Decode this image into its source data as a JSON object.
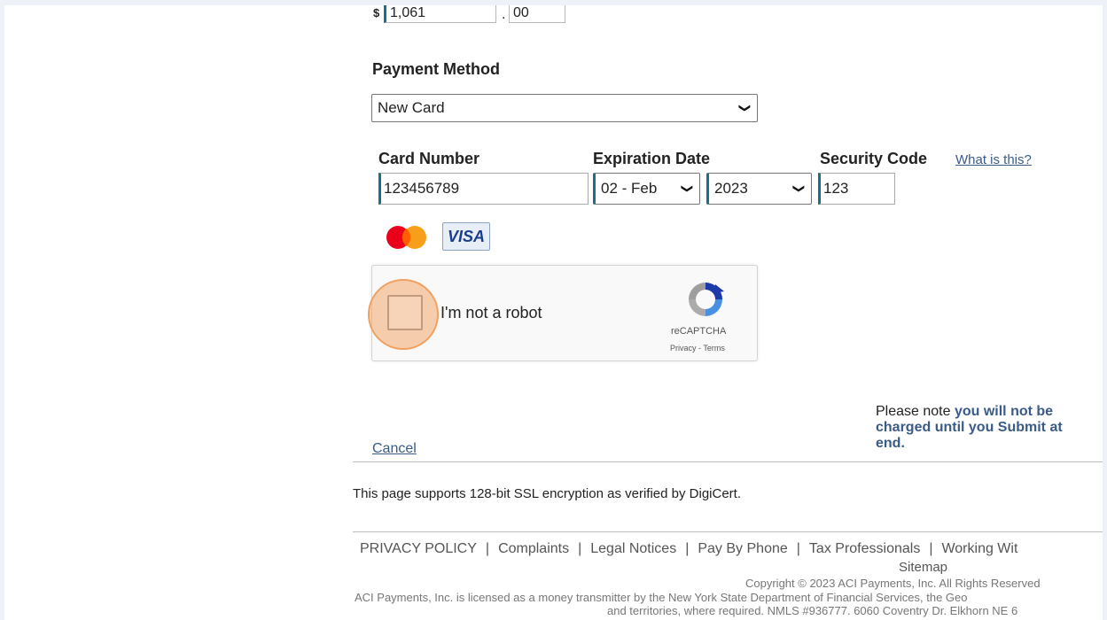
{
  "payment": {
    "currency_symbol": "$",
    "amount_dollars": "1,061",
    "decimal_sep": ".",
    "amount_cents": "00"
  },
  "method": {
    "title": "Payment Method",
    "selected": "New Card"
  },
  "card": {
    "number_label": "Card Number",
    "number_value": "123456789",
    "expiration_label": "Expiration Date",
    "month_value": "02 - Feb",
    "year_value": "2023",
    "security_label": "Security Code",
    "security_value": "123",
    "what_is_this": "What is this?",
    "brands": [
      "mastercard",
      "VISA"
    ]
  },
  "captcha": {
    "label": "I'm not a robot",
    "brand": "reCAPTCHA",
    "links": "Privacy - Terms"
  },
  "note": {
    "prefix": "Please note ",
    "emphasis": "you will not be charged until you Submit at end."
  },
  "actions": {
    "cancel": "Cancel"
  },
  "security_notice": "This page supports 128-bit SSL encryption as verified by DigiCert.",
  "footer": {
    "links": [
      "PRIVACY POLICY",
      "Complaints",
      "Legal Notices",
      "Pay By Phone",
      "Tax Professionals",
      "Working Wit"
    ],
    "sitemap": "Sitemap",
    "copyright": "Copyright © 2023 ACI Payments, Inc. All Rights Reserved",
    "license_line1": "ACI Payments, Inc. is licensed as a money transmitter by the New York State Department of Financial Services, the Geo",
    "license_line2": "and territories, where required. NMLS #936777. 6060 Coventry Dr. Elkhorn NE 6"
  },
  "colors": {
    "accent": "#1a6f8a",
    "link": "#3a5a88",
    "highlight": "#f0a060"
  }
}
